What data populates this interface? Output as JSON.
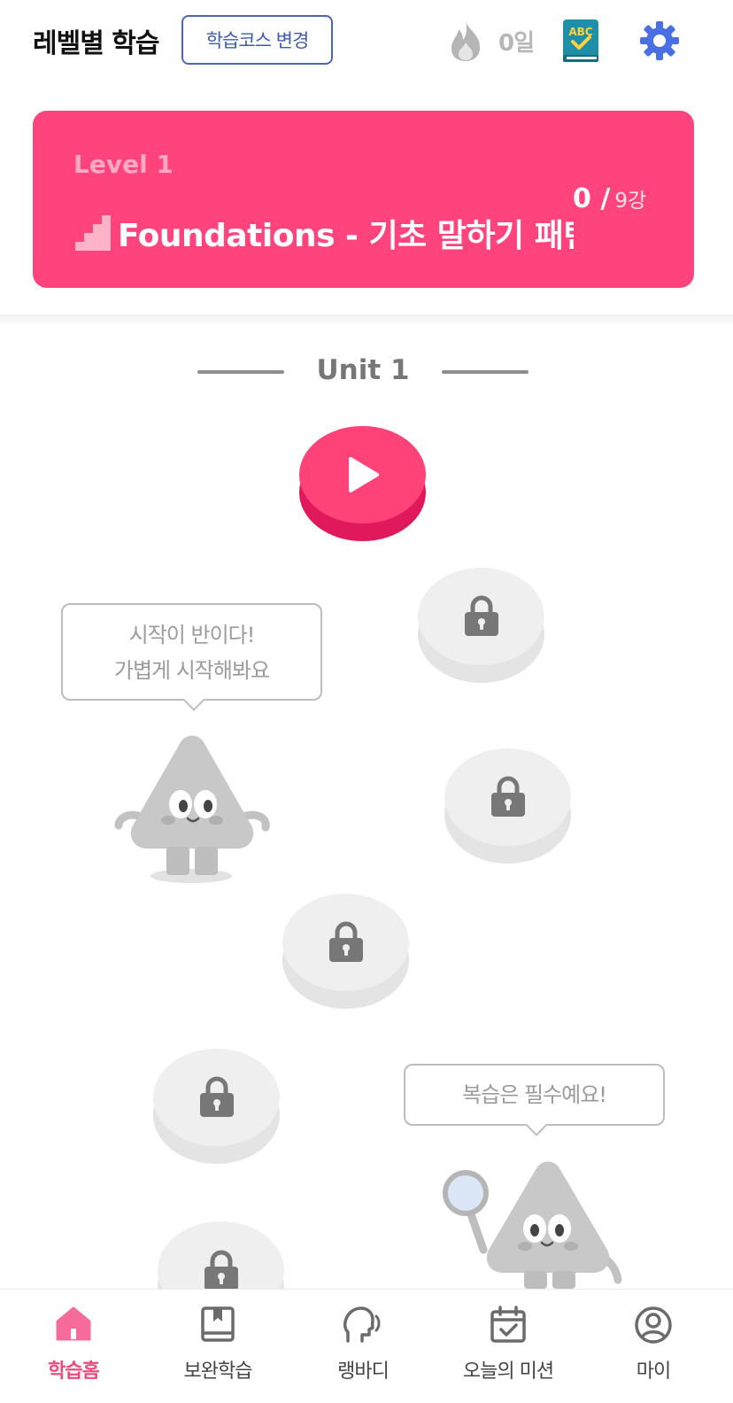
{
  "header": {
    "title": "레벨별 학습",
    "change_course_label": "학습코스 변경",
    "streak_label": "0일",
    "icons": [
      "flame-icon",
      "abc-book-icon",
      "gear-icon"
    ],
    "accent_color": "#4a6fe3"
  },
  "level_card": {
    "level_label": "Level 1",
    "course_title": "Foundations - 기초 말하기 패턴",
    "progress_done": "0 /",
    "progress_total": "9강",
    "background_color": "#ff437c"
  },
  "unit": {
    "title": "Unit 1"
  },
  "lessons": [
    {
      "state": "current",
      "icon": "play-icon"
    },
    {
      "state": "locked",
      "icon": "lock-icon"
    },
    {
      "state": "locked",
      "icon": "lock-icon"
    },
    {
      "state": "locked",
      "icon": "lock-icon"
    },
    {
      "state": "locked",
      "icon": "lock-icon"
    },
    {
      "state": "locked",
      "icon": "lock-icon"
    }
  ],
  "bubbles": {
    "start_line1": "시작이 반이다!",
    "start_line2": "가볍게 시작해봐요",
    "review": "복습은 필수예요!"
  },
  "bottom_nav": {
    "items": [
      {
        "label": "학습홈",
        "icon": "home-icon",
        "active": true
      },
      {
        "label": "보완학습",
        "icon": "book-icon",
        "active": false
      },
      {
        "label": "랭바디",
        "icon": "speaking-head-icon",
        "active": false
      },
      {
        "label": "오늘의 미션",
        "icon": "calendar-check-icon",
        "active": false
      },
      {
        "label": "마이",
        "icon": "profile-icon",
        "active": false
      }
    ],
    "active_color": "#ef4a7d"
  }
}
